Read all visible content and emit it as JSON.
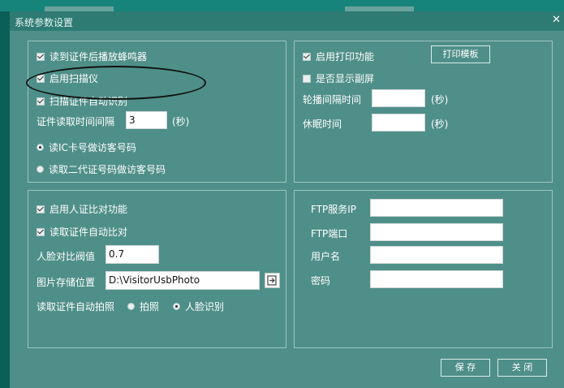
{
  "window": {
    "title": "系统参数设置",
    "close_icon": "close-icon"
  },
  "scanner_panel": {
    "play_buzzer": {
      "label": "读到证件后播放蜂鸣器",
      "checked": true
    },
    "enable_scanner": {
      "label": "启用扫描仪",
      "checked": true
    },
    "scan_auto_detect": {
      "label": "扫描证件自动识别",
      "checked": true
    },
    "read_interval": {
      "label": "证件读取时间间隔",
      "value": "3",
      "unit": "(秒)"
    },
    "radio_ic": {
      "label": "读IC卡号做访客号码",
      "selected": true
    },
    "radio_id2": {
      "label": "读取二代证号码做访客号码",
      "selected": false
    }
  },
  "print_panel": {
    "enable_print": {
      "label": "启用打印功能",
      "checked": true
    },
    "template_button": "打印模板",
    "show_subscreen": {
      "label": "是否显示副屏",
      "checked": false
    },
    "carousel_interval": {
      "label": "轮播间隔时间",
      "value": "",
      "unit": "(秒)"
    },
    "sleep_time": {
      "label": "休眠时间",
      "value": "",
      "unit": "(秒)"
    }
  },
  "face_panel": {
    "enable_compare": {
      "label": "启用人证比对功能",
      "checked": true
    },
    "auto_compare": {
      "label": "读取证件自动比对",
      "checked": true
    },
    "threshold": {
      "label": "人脸对比阀值",
      "value": "0.7"
    },
    "storage": {
      "label": "图片存储位置",
      "value": "D:\\VisitorUsbPhoto"
    },
    "auto_photo": {
      "label": "读取证件自动拍照",
      "option_photo": "拍照",
      "option_face": "人脸识别",
      "selected": "option_face"
    }
  },
  "ftp_panel": {
    "server_ip": {
      "label": "FTP服务IP",
      "value": ""
    },
    "port": {
      "label": "FTP端口",
      "value": ""
    },
    "username": {
      "label": "用户名",
      "value": ""
    },
    "password": {
      "label": "密码",
      "value": ""
    }
  },
  "footer": {
    "save": "保 存",
    "close": "关 闭"
  }
}
